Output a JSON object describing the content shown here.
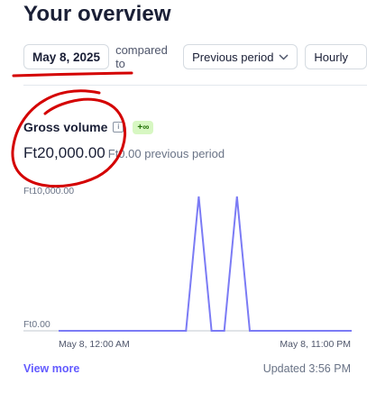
{
  "page": {
    "title": "Your overview"
  },
  "filters": {
    "date": "May 8, 2025",
    "compared_label": "compared to",
    "period": "Previous period",
    "granularity": "Hourly"
  },
  "metric": {
    "label": "Gross volume",
    "info_icon": "info-icon",
    "badge": "+∞",
    "value": "Ft20,000.00",
    "previous": "Ft0.00 previous period"
  },
  "chart_data": {
    "type": "line",
    "y_top_label": "Ft10,000.00",
    "y_bottom_label": "Ft0.00",
    "x_start_label": "May 8, 12:00 AM",
    "x_end_label": "May 8, 11:00 PM",
    "x": [
      "12:00 AM",
      "1:00 AM",
      "2:00 AM",
      "3:00 AM",
      "4:00 AM",
      "5:00 AM",
      "6:00 AM",
      "7:00 AM",
      "8:00 AM",
      "9:00 AM",
      "10:00 AM",
      "11:00 AM",
      "12:00 PM",
      "1:00 PM",
      "2:00 PM",
      "3:00 PM",
      "4:00 PM",
      "5:00 PM",
      "6:00 PM",
      "7:00 PM",
      "8:00 PM",
      "9:00 PM",
      "10:00 PM",
      "11:00 PM"
    ],
    "series": [
      {
        "values": [
          0,
          0,
          0,
          0,
          0,
          0,
          0,
          0,
          0,
          0,
          0,
          10000,
          0,
          0,
          10000,
          0,
          0,
          0,
          0,
          0,
          0,
          0,
          0,
          0
        ]
      }
    ],
    "ylim": [
      0,
      10000
    ],
    "color": "#7b7bf5"
  },
  "footer": {
    "view_more": "View more",
    "updated": "Updated 3:56 PM"
  },
  "annotation": {
    "color": "#d40000"
  }
}
